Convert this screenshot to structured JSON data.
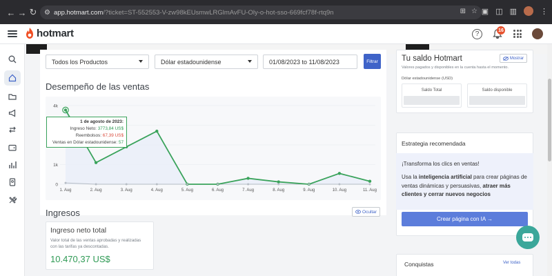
{
  "browser": {
    "url_domain": "app.hotmart.com",
    "url_rest": "/?ticket=ST-552553-V-zw98kEUsmwLRGlmAvFU-Oly-o-hot-sso-669fcf78f-rtq9n"
  },
  "header": {
    "logo": "hotmart",
    "notification_count": "16"
  },
  "filters": {
    "product": "Todos los Productos",
    "currency": "Dólar estadounidense",
    "date_range": "01/08/2023 to 11/08/2023",
    "submit_label": "Filtrar"
  },
  "sales": {
    "title": "Desempeño de las ventas",
    "tooltip": {
      "date": "1 de agosto de 2023:",
      "net_label": "Ingreso Neto:",
      "net_value": "3773,84 US$",
      "refund_label": "Reembolsos:",
      "refund_value": "67,39 US$",
      "count_label": "Ventas en Dólar estadounidense:",
      "count_value": "57"
    }
  },
  "chart_data": {
    "type": "line",
    "categories": [
      "1. Aug",
      "2. Aug",
      "3. Aug",
      "4. Aug",
      "5. Aug",
      "6. Aug",
      "7. Aug",
      "8. Aug",
      "9. Aug",
      "10. Aug",
      "11. Aug"
    ],
    "yticks": [
      "0",
      "1k",
      "4k"
    ],
    "ylim": [
      0,
      4000
    ],
    "series": [
      {
        "values": [
          3774,
          1100,
          1900,
          2700,
          0,
          0,
          300,
          120,
          0,
          550,
          150
        ],
        "color": "#3aa35b"
      },
      {
        "values": [
          67,
          0,
          0,
          0,
          0,
          0,
          0,
          0,
          0,
          0,
          0
        ],
        "color": "#b5bcc4"
      }
    ]
  },
  "ingresos": {
    "title": "Ingresos",
    "hide_label": "Ocultar",
    "card_title": "Ingreso neto total",
    "card_desc_1": "Valor total de las ventas aprobadas y realizadas",
    "card_desc_2": "con las tarifas ya descontadas.",
    "card_value": "10.470,37 US$"
  },
  "saldo": {
    "title": "Tu saldo Hotmart",
    "show_label": "Mostrar",
    "desc": "Valores pagados y disponibles en la cuenta hasta el momento.",
    "currency": "Dólar estadounidense (USD)",
    "total_label": "Saldo Total",
    "available_label": "Saldo disponible"
  },
  "estrategia": {
    "title": "Estrategia recomendada",
    "heading": "¡Transforma los clics en ventas!",
    "text_1": "Usa la ",
    "text_bold_1": "inteligencia artificial",
    "text_2": " para crear páginas de ventas dinámicas y persuasivas, ",
    "text_bold_2": "atraer más clientes y cerrar nuevos negocios",
    "cta_label": "Crear página con IA →"
  },
  "conquistas": {
    "title": "Conquistas",
    "link": "Ver todas"
  }
}
